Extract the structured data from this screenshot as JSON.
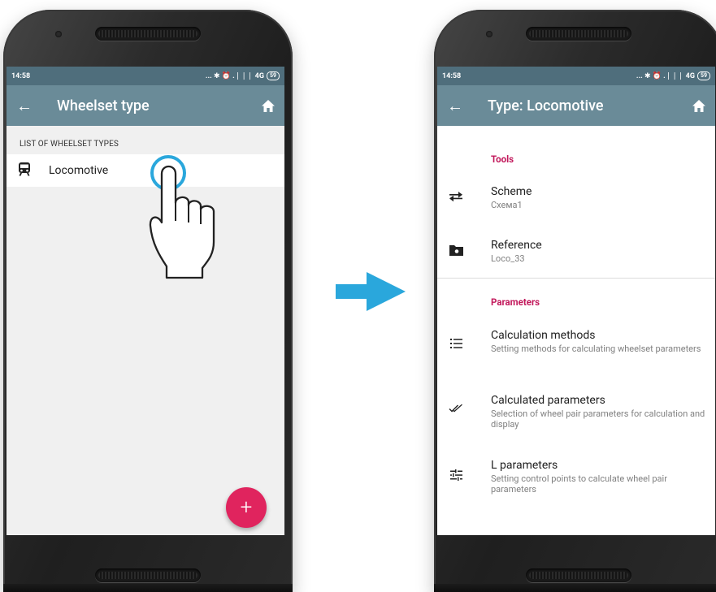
{
  "left_screen": {
    "status_time": "14:58",
    "status_icons": "... ✱ ⏰ .❘❘❘ 4G",
    "battery": "59",
    "title": "Wheelset type",
    "list_header": "LIST OF WHEELSET TYPES",
    "items": [
      {
        "label": "Locomotive",
        "icon": "train-icon"
      }
    ],
    "fab_label": "+"
  },
  "right_screen": {
    "status_time": "14:58",
    "status_icons": "... ✱ ⏰ .❘❘❘ 4G",
    "battery": "59",
    "title": "Type: Locomotive",
    "tools_header": "Tools",
    "tools": [
      {
        "title": "Scheme",
        "subtitle": "Схема1",
        "icon": "swap-icon"
      },
      {
        "title": "Reference",
        "subtitle": "Loco_33",
        "icon": "folder-icon"
      }
    ],
    "params_header": "Parameters",
    "params": [
      {
        "title": "Calculation methods",
        "subtitle": "Setting methods for calculating wheelset parameters",
        "icon": "list-icon"
      },
      {
        "title": "Calculated parameters",
        "subtitle": "Selection of wheel pair parameters for calculation and display",
        "icon": "done-all-icon"
      },
      {
        "title": "L parameters",
        "subtitle": "Setting control points to calculate wheel pair parameters",
        "icon": "tune-icon"
      }
    ]
  },
  "colors": {
    "statusbar": "#4f6e7c",
    "toolbar": "#6a8b98",
    "accent": "#c2185b",
    "fab": "#e0245e",
    "arrow": "#2aa7dc"
  }
}
